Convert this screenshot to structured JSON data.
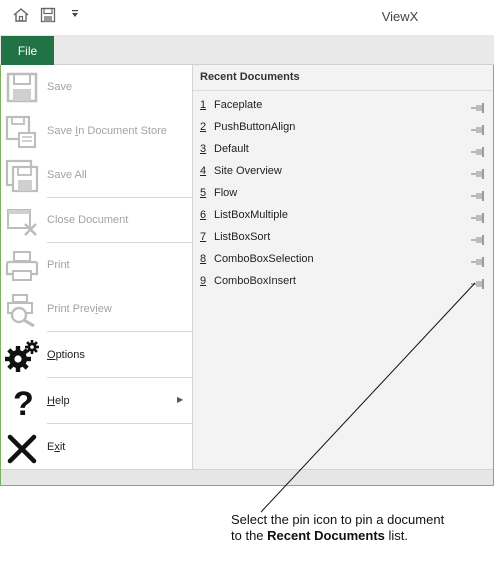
{
  "window": {
    "title": "ViewX"
  },
  "ribbon": {
    "file_tab": "File"
  },
  "menu": {
    "save": "Save",
    "save_store": "Save In Document Store",
    "save_all": "Save All",
    "close_document": "Close Document",
    "print": "Print",
    "print_preview": "Print Preview",
    "options": "Options",
    "help": "Help",
    "exit": "Exit"
  },
  "recent": {
    "heading": "Recent Documents",
    "items": [
      {
        "num": "1",
        "name": "Faceplate"
      },
      {
        "num": "2",
        "name": "PushButtonAlign"
      },
      {
        "num": "3",
        "name": "Default"
      },
      {
        "num": "4",
        "name": "Site Overview"
      },
      {
        "num": "5",
        "name": "Flow"
      },
      {
        "num": "6",
        "name": "ListBoxMultiple"
      },
      {
        "num": "7",
        "name": "ListBoxSort"
      },
      {
        "num": "8",
        "name": "ComboBoxSelection"
      },
      {
        "num": "9",
        "name": "ComboBoxInsert"
      }
    ]
  },
  "callout": {
    "line1": "Select the pin icon to pin a document",
    "line2_pre": "to the ",
    "line2_bold": "Recent Documents",
    "line2_post": " list."
  },
  "colors": {
    "file_tab": "#217346",
    "frame_border": "#7ab35c"
  },
  "icons": [
    "home-icon",
    "save-icon",
    "customize-arrow-icon",
    "save-store-icon",
    "save-all-icon",
    "close-document-icon",
    "print-icon",
    "print-preview-icon",
    "options-gear-icon",
    "help-question-icon",
    "exit-x-icon",
    "pin-icon"
  ]
}
